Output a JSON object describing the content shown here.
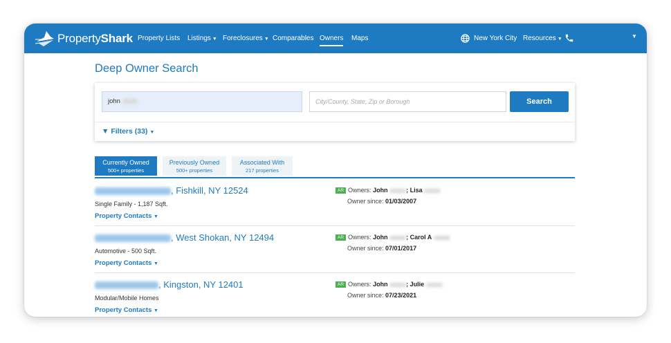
{
  "brand": {
    "name_light": "Property",
    "name_bold": "Shark"
  },
  "nav": {
    "items": [
      {
        "label": "Property Lists"
      },
      {
        "label": "Listings"
      },
      {
        "label": "Foreclosures"
      },
      {
        "label": "Comparables"
      },
      {
        "label": "Owners",
        "active": true
      },
      {
        "label": "Maps"
      }
    ],
    "location": "New York City",
    "resources": "Resources"
  },
  "page": {
    "title": "Deep Owner Search"
  },
  "search": {
    "name_value": "john",
    "location_placeholder": "City/County, State, Zip or Borough",
    "button": "Search",
    "filters": "Filters (33)"
  },
  "tabs": [
    {
      "label": "Currently Owned",
      "count": "500+ properties",
      "active": true
    },
    {
      "label": "Previously Owned",
      "count": "500+ properties"
    },
    {
      "label": "Associated With",
      "count": "217 properties"
    }
  ],
  "results": [
    {
      "address_suffix": ", Fishkill, NY 12524",
      "type": "Single Family - 1,187 Sqft.",
      "contacts_label": "Property Contacts",
      "badge": "AR",
      "owners_label": "Owners:",
      "owner1": "John",
      "owner2": "; Lisa",
      "since_label": "Owner since:",
      "since": "01/03/2007"
    },
    {
      "address_suffix": ", West Shokan, NY 12494",
      "type": "Automotive - 500 Sqft.",
      "contacts_label": "Property Contacts",
      "badge": "AR",
      "owners_label": "Owners:",
      "owner1": "John",
      "owner2": "; Carol A",
      "since_label": "Owner since:",
      "since": "07/01/2017"
    },
    {
      "address_suffix": ", Kingston, NY 12401",
      "type": "Modular/Mobile Homes",
      "contacts_label": "Property Contacts",
      "badge": "AR",
      "owners_label": "Owners:",
      "owner1": "John",
      "owner2": "; Julie",
      "since_label": "Owner since:",
      "since": "07/23/2021"
    }
  ],
  "colors": {
    "brand_blue": "#1f7bc1",
    "badge_green": "#4caf50"
  }
}
